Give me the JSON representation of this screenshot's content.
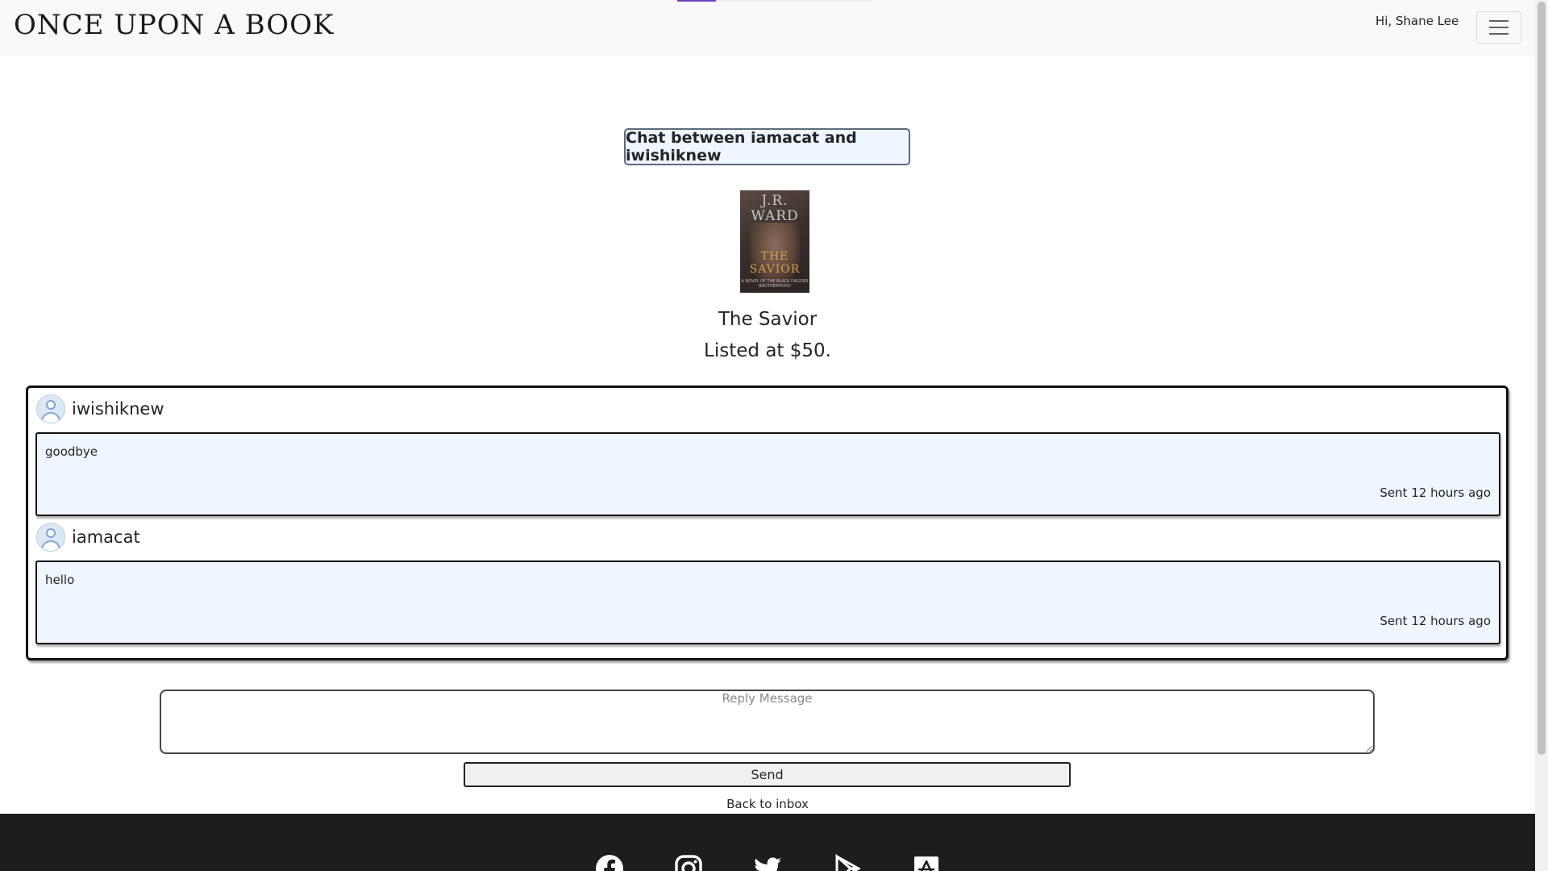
{
  "header": {
    "brand": "ONCE UPON A BOOK",
    "greeting": "Hi, Shane Lee",
    "menu_icon": "hamburger-icon",
    "progress_fraction": 0.2
  },
  "chat": {
    "title": "Chat between iamacat and iwishiknew"
  },
  "book": {
    "cover": {
      "author": "J.R. WARD",
      "title": "THE SAVIOR",
      "series": "A NOVEL OF THE BLACK DAGGER BROTHERHOOD"
    },
    "title": "The Savior",
    "price_text": "Listed at $50."
  },
  "messages": [
    {
      "sender": "iwishiknew",
      "text": "goodbye",
      "time": "Sent 12 hours ago",
      "avatar_icon": "user-avatar-icon"
    },
    {
      "sender": "iamacat",
      "text": "hello",
      "time": "Sent 12 hours ago",
      "avatar_icon": "user-avatar-icon"
    }
  ],
  "reply": {
    "placeholder": "Reply Message",
    "send_label": "Send",
    "back_label": "Back to inbox"
  },
  "footer": {
    "social_icons": [
      "facebook-icon",
      "instagram-icon",
      "twitter-icon",
      "google-play-icon",
      "app-store-icon"
    ]
  },
  "colors": {
    "accent": "#6f42c1",
    "message_bg": "#f0f6ff",
    "footer_bg": "#1d1d1d"
  }
}
